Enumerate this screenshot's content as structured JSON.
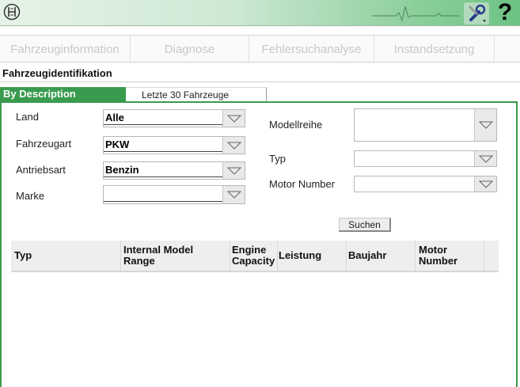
{
  "header": {
    "logo_icon": "bosch-logo-icon",
    "tool_icon": "wrench-settings-icon",
    "help_label": "?",
    "accent": "#3a9b4e"
  },
  "nav": {
    "tabs": [
      "Fahrzeuginformation",
      "Diagnose",
      "Fehlersuchanalyse",
      "Instandsetzung"
    ]
  },
  "section": {
    "title": "Fahrzeugidentifikation"
  },
  "subtabs": {
    "active": "By Description",
    "other": "Letzte 30 Fahrzeuge"
  },
  "form": {
    "land": {
      "label": "Land",
      "value": "Alle"
    },
    "fahrzeugart": {
      "label": "Fahrzeugart",
      "value": "PKW"
    },
    "antriebsart": {
      "label": "Antriebsart",
      "value": "Benzin"
    },
    "marke": {
      "label": "Marke",
      "value": ""
    },
    "modellreihe": {
      "label": "Modellreihe",
      "value": ""
    },
    "typ": {
      "label": "Typ",
      "value": ""
    },
    "motor_number": {
      "label": "Motor Number",
      "value": ""
    },
    "search_label": "Suchen"
  },
  "table": {
    "columns": [
      "Typ",
      "Internal Model Range",
      "Engine Capacity",
      "Leistung",
      "Baujahr",
      "Motor Number"
    ],
    "rows": []
  }
}
